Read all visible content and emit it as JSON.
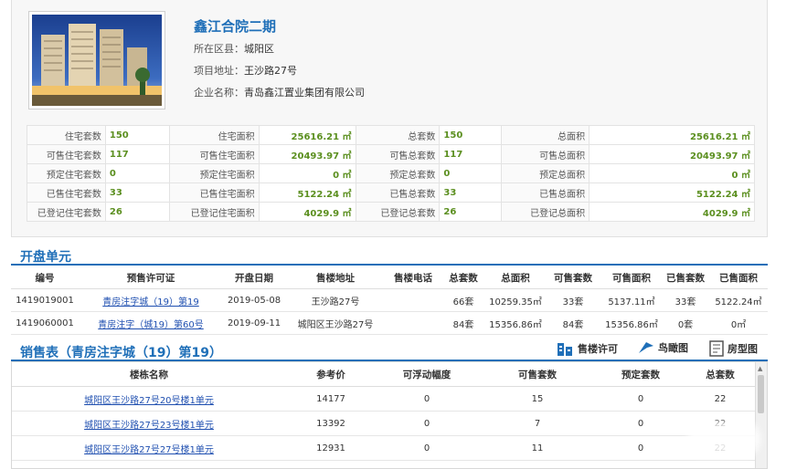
{
  "project": {
    "name": "鑫江合院二期",
    "district_label": "所在区县：",
    "district": "城阳区",
    "address_label": "项目地址：",
    "address": "王沙路27号",
    "company_label": "企业名称：",
    "company": "青岛鑫江置业集团有限公司"
  },
  "stats": [
    [
      "住宅套数",
      "150",
      "住宅面积",
      "25616.21 ㎡",
      "总套数",
      "150",
      "总面积",
      "25616.21 ㎡"
    ],
    [
      "可售住宅套数",
      "117",
      "可售住宅面积",
      "20493.97 ㎡",
      "可售总套数",
      "117",
      "可售总面积",
      "20493.97 ㎡"
    ],
    [
      "预定住宅套数",
      "0",
      "预定住宅面积",
      "0 ㎡",
      "预定总套数",
      "0",
      "预定总面积",
      "0 ㎡"
    ],
    [
      "已售住宅套数",
      "33",
      "已售住宅面积",
      "5122.24 ㎡",
      "已售总套数",
      "33",
      "已售总面积",
      "5122.24 ㎡"
    ],
    [
      "已登记住宅套数",
      "26",
      "已登记住宅面积",
      "4029.9 ㎡",
      "已登记总套数",
      "26",
      "已登记总面积",
      "4029.9 ㎡"
    ]
  ],
  "units_section": {
    "title": "开盘单元",
    "headers": [
      "编号",
      "预售许可证",
      "开盘日期",
      "售楼地址",
      "售楼电话",
      "总套数",
      "总面积",
      "可售套数",
      "可售面积",
      "已售套数",
      "已售面积"
    ],
    "rows": [
      [
        "1419019001",
        "青房注字城（19）第19",
        "2019-05-08",
        "王沙路27号",
        "",
        "66套",
        "10259.35㎡",
        "33套",
        "5137.11㎡",
        "33套",
        "5122.24㎡"
      ],
      [
        "1419060001",
        "青房注字（城19）第60号",
        "2019-09-11",
        "城阳区王沙路27号",
        "",
        "84套",
        "15356.86㎡",
        "84套",
        "15356.86㎡",
        "0套",
        "0㎡"
      ]
    ]
  },
  "sales_section": {
    "title": "销售表（青房注字城（19）第19）",
    "tools": [
      {
        "label": "售楼许可",
        "icon": "building-icon"
      },
      {
        "label": "鸟瞰图",
        "icon": "bird-icon"
      },
      {
        "label": "房型图",
        "icon": "floorplan-icon"
      }
    ],
    "headers": [
      "楼栋名称",
      "参考价",
      "可浮动幅度",
      "可售套数",
      "预定套数",
      "总套数"
    ],
    "rows": [
      [
        "城阳区王沙路27号20号楼1单元",
        "14177",
        "0",
        "15",
        "0",
        "22"
      ],
      [
        "城阳区王沙路27号23号楼1单元",
        "13392",
        "0",
        "7",
        "0",
        "22"
      ],
      [
        "城阳区王沙路27号27号楼1单元",
        "12931",
        "0",
        "11",
        "0",
        "22"
      ]
    ]
  },
  "colors": {
    "accent": "#1f6fb8",
    "value_green": "#5b8f1f",
    "link": "#1f4fb0"
  }
}
